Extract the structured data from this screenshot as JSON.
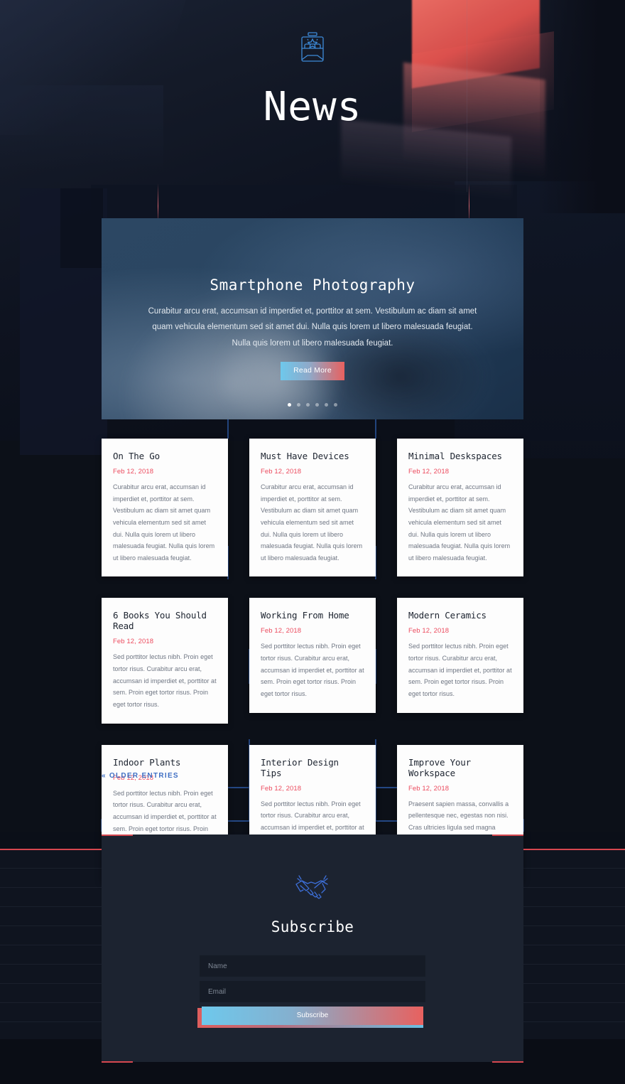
{
  "header": {
    "title": "News",
    "icon": "briefcase-star-icon"
  },
  "hero": {
    "title": "Smartphone Photography",
    "text": "Curabitur arcu erat, accumsan id imperdiet et, porttitor at sem. Vestibulum ac diam sit amet quam vehicula elementum sed sit amet dui. Nulla quis lorem ut libero malesuada feugiat. Nulla quis lorem ut libero malesuada feugiat.",
    "button": "Read More",
    "dots_count": 6,
    "active_dot": 0
  },
  "posts": [
    {
      "title": "On The Go",
      "date": "Feb 12, 2018",
      "excerpt": "Curabitur arcu erat, accumsan id imperdiet et, porttitor at sem. Vestibulum ac diam sit amet quam vehicula elementum sed sit amet dui. Nulla quis lorem ut libero malesuada feugiat. Nulla quis lorem ut libero malesuada feugiat."
    },
    {
      "title": "Must Have Devices",
      "date": "Feb 12, 2018",
      "excerpt": "Curabitur arcu erat, accumsan id imperdiet et, porttitor at sem. Vestibulum ac diam sit amet quam vehicula elementum sed sit amet dui. Nulla quis lorem ut libero malesuada feugiat. Nulla quis lorem ut libero malesuada feugiat."
    },
    {
      "title": "Minimal Deskspaces",
      "date": "Feb 12, 2018",
      "excerpt": "Curabitur arcu erat, accumsan id imperdiet et, porttitor at sem. Vestibulum ac diam sit amet quam vehicula elementum sed sit amet dui. Nulla quis lorem ut libero malesuada feugiat. Nulla quis lorem ut libero malesuada feugiat."
    },
    {
      "title": "6 Books You Should Read",
      "date": "Feb 12, 2018",
      "excerpt": "Sed porttitor lectus nibh. Proin eget tortor risus. Curabitur arcu erat, accumsan id imperdiet et, porttitor at sem. Proin eget tortor risus. Proin eget tortor risus."
    },
    {
      "title": "Working From Home",
      "date": "Feb 12, 2018",
      "excerpt": "Sed porttitor lectus nibh. Proin eget tortor risus. Curabitur arcu erat, accumsan id imperdiet et, porttitor at sem. Proin eget tortor risus. Proin eget tortor risus."
    },
    {
      "title": "Modern Ceramics",
      "date": "Feb 12, 2018",
      "excerpt": "Sed porttitor lectus nibh. Proin eget tortor risus. Curabitur arcu erat, accumsan id imperdiet et, porttitor at sem. Proin eget tortor risus. Proin eget tortor risus."
    },
    {
      "title": "Indoor Plants",
      "date": "Feb 12, 2018",
      "excerpt": "Sed porttitor lectus nibh. Proin eget tortor risus. Curabitur arcu erat, accumsan id imperdiet et, porttitor at sem. Proin eget tortor risus. Proin eget tortor risus."
    },
    {
      "title": "Interior Design Tips",
      "date": "Feb 12, 2018",
      "excerpt": "Sed porttitor lectus nibh. Proin eget tortor risus. Curabitur arcu erat, accumsan id imperdiet et, porttitor at sem. Proin eget tortor risus. Proin eget tortor risus."
    },
    {
      "title": "Improve Your Workspace",
      "date": "Feb 12, 2018",
      "excerpt": "Praesent sapien massa, convallis a pellentesque nec, egestas non nisi. Cras ultricies ligula sed magna dictum porta. Curabitur arcu erat, accumsan id imperdiet et, porttitor at sem."
    }
  ],
  "pagination": {
    "older_label": "Older Entries",
    "chevron": "«"
  },
  "subscribe": {
    "icon": "handshake-icon",
    "title": "Subscribe",
    "name_placeholder": "Name",
    "name_value": "",
    "email_placeholder": "Email",
    "email_value": "",
    "button": "Subscribe"
  },
  "colors": {
    "accent_red": "#ec4b5e",
    "accent_blue": "#3f6fc4",
    "icon_blue": "#3d8ad8",
    "page_bg": "#0c1018",
    "card_bg": "#fdfdfd",
    "subscribe_bg": "#1c2330"
  }
}
